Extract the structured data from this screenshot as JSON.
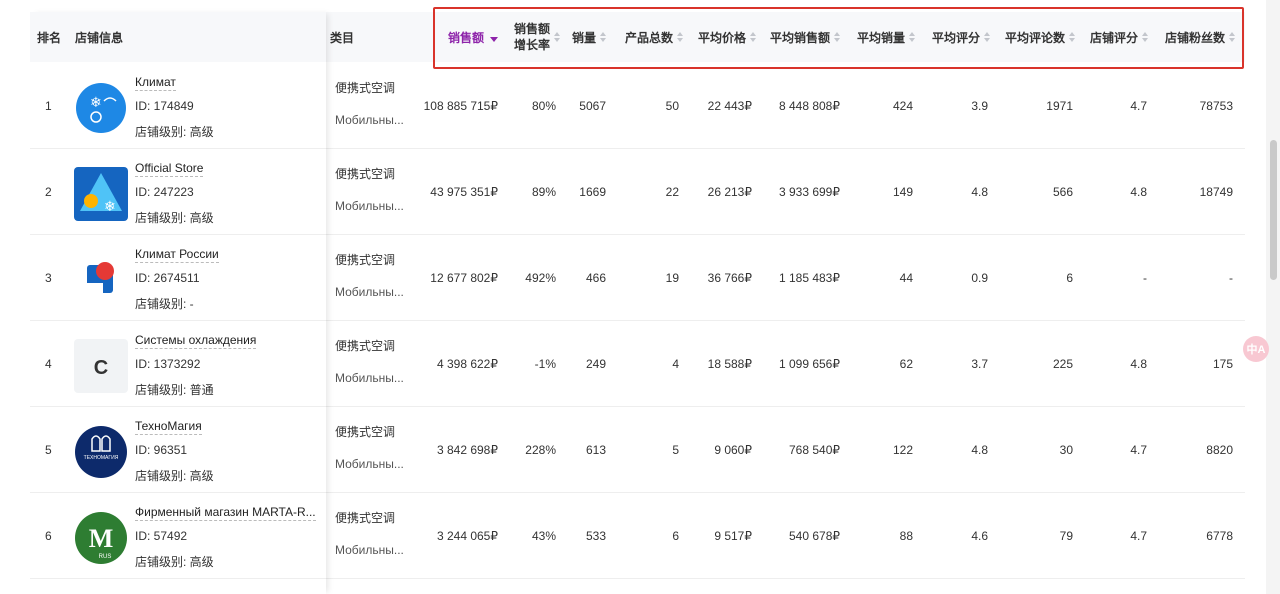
{
  "header": {
    "rank": "排名",
    "store_info": "店铺信息",
    "category": "类目",
    "sales": "销售额",
    "growth_line1": "销售额",
    "growth_line2": "增长率",
    "volume": "销量",
    "products": "产品总数",
    "avg_price": "平均价格",
    "avg_sales": "平均销售额",
    "avg_volume": "平均销量",
    "avg_rating": "平均评分",
    "avg_reviews": "平均评论数",
    "store_rating": "店铺评分",
    "followers": "店铺粉丝数"
  },
  "rows": [
    {
      "rank": "1",
      "name": "Климат",
      "id": "ID: 174849",
      "level": "店铺级别: 高级",
      "cat1": "便携式空调",
      "cat2": "Мобильны...",
      "sales": "108 885 715₽",
      "growth": "80%",
      "volume": "5067",
      "products": "50",
      "avg_price": "22 443₽",
      "avg_sales": "8 448 808₽",
      "avg_volume": "424",
      "avg_rating": "3.9",
      "avg_reviews": "1971",
      "store_rating": "4.7",
      "followers": "78753"
    },
    {
      "rank": "2",
      "name": "Official Store",
      "id": "ID: 247223",
      "level": "店铺级别: 高级",
      "cat1": "便携式空调",
      "cat2": "Мобильны...",
      "sales": "43 975 351₽",
      "growth": "89%",
      "volume": "1669",
      "products": "22",
      "avg_price": "26 213₽",
      "avg_sales": "3 933 699₽",
      "avg_volume": "149",
      "avg_rating": "4.8",
      "avg_reviews": "566",
      "store_rating": "4.8",
      "followers": "18749"
    },
    {
      "rank": "3",
      "name": "Климат России",
      "id": "ID: 2674511",
      "level": "店铺级别: -",
      "cat1": "便携式空调",
      "cat2": "Мобильны...",
      "sales": "12 677 802₽",
      "growth": "492%",
      "volume": "466",
      "products": "19",
      "avg_price": "36 766₽",
      "avg_sales": "1 185 483₽",
      "avg_volume": "44",
      "avg_rating": "0.9",
      "avg_reviews": "6",
      "store_rating": "-",
      "followers": "-"
    },
    {
      "rank": "4",
      "name": "Системы охлаждения",
      "id": "ID: 1373292",
      "level": "店铺级别: 普通",
      "cat1": "便携式空调",
      "cat2": "Мобильны...",
      "sales": "4 398 622₽",
      "growth": "-1%",
      "volume": "249",
      "products": "4",
      "avg_price": "18 588₽",
      "avg_sales": "1 099 656₽",
      "avg_volume": "62",
      "avg_rating": "3.7",
      "avg_reviews": "225",
      "store_rating": "4.8",
      "followers": "175",
      "logo_letter": "C"
    },
    {
      "rank": "5",
      "name": "ТехноМагия",
      "id": "ID: 96351",
      "level": "店铺级别: 高级",
      "cat1": "便携式空调",
      "cat2": "Мобильны...",
      "sales": "3 842 698₽",
      "growth": "228%",
      "volume": "613",
      "products": "5",
      "avg_price": "9 060₽",
      "avg_sales": "768 540₽",
      "avg_volume": "122",
      "avg_rating": "4.8",
      "avg_reviews": "30",
      "store_rating": "4.7",
      "followers": "8820",
      "logo_text": "ТЕХНОМАГИЯ"
    },
    {
      "rank": "6",
      "name": "Фирменный магазин MARTA-R...",
      "id": "ID: 57492",
      "level": "店铺级别: 高级",
      "cat1": "便携式空调",
      "cat2": "Мобильны...",
      "sales": "3 244 065₽",
      "growth": "43%",
      "volume": "533",
      "products": "6",
      "avg_price": "9 517₽",
      "avg_sales": "540 678₽",
      "avg_volume": "88",
      "avg_rating": "4.6",
      "avg_reviews": "79",
      "store_rating": "4.7",
      "followers": "6778",
      "logo_letter": "M",
      "logo_sub": "RUS"
    }
  ],
  "float_button": "中A",
  "colors": {
    "accent": "#8e24aa",
    "highlight": "#d9342b",
    "header_bg": "#f7f8fa"
  }
}
